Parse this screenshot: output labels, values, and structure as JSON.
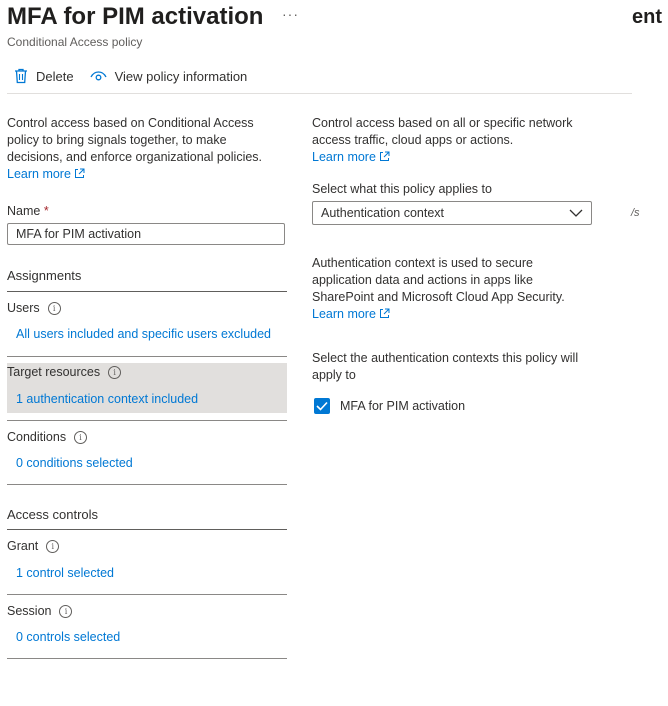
{
  "header": {
    "title": "MFA for PIM activation",
    "more": "···",
    "right_cut_text": "ent",
    "subtitle": "Conditional Access policy"
  },
  "toolbar": {
    "delete_label": "Delete",
    "view_policy_label": "View policy information"
  },
  "left": {
    "intro": "Control access based on Conditional Access policy to bring signals together, to make decisions, and enforce organizational policies.",
    "learn_more": "Learn more",
    "name_label": "Name",
    "name_required": "*",
    "name_value": "MFA for PIM activation",
    "assignments_heading": "Assignments",
    "users_label": "Users",
    "users_link": "All users included and specific users excluded",
    "target_label": "Target resources",
    "target_link": "1 authentication context included",
    "conditions_label": "Conditions",
    "conditions_link": "0 conditions selected",
    "access_heading": "Access controls",
    "grant_label": "Grant",
    "grant_link": "1 control selected",
    "session_label": "Session",
    "session_link": "0 controls selected"
  },
  "right": {
    "intro": "Control access based on all or specific network access traffic, cloud apps or actions.",
    "learn_more": "Learn more",
    "select_label": "Select what this policy applies to",
    "dropdown_value": "Authentication context",
    "cut_text": "/s",
    "auth_desc": "Authentication context is used to secure application data and actions in apps like SharePoint and Microsoft Cloud App Security.",
    "learn_more_2": "Learn more",
    "contexts_label": "Select the authentication contexts this policy will apply to",
    "checkbox_label": "MFA for PIM activation"
  },
  "colors": {
    "link": "#0078d4",
    "selected_row": "#e1dfdd",
    "required": "#a4262c"
  },
  "icons": [
    "trash-icon",
    "eye-icon",
    "external-link-icon",
    "info-icon",
    "chevron-down-icon",
    "checkmark-icon"
  ]
}
